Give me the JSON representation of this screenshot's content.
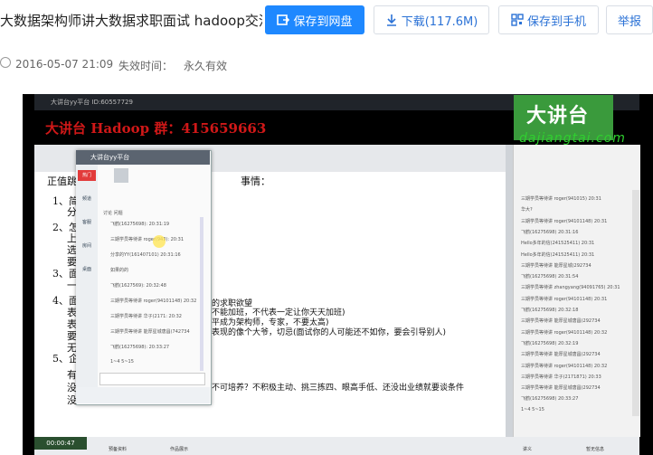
{
  "header": {
    "title": "大数据架构师讲大数据求职面试 hadoop交流...",
    "buttons": {
      "save_cloud": "保存到网盘",
      "download": "下载(117.6M)",
      "save_phone": "保存到手机",
      "report": "举报"
    },
    "meta": {
      "datetime": "2016-05-07 21:09",
      "expiry_label": "失效时间：",
      "expiry_value": "永久有效"
    }
  },
  "video": {
    "top_strip_text": "大讲台yy平台 ID:60557729",
    "banner_title": "大讲台 Hadoop 群：415659663",
    "logo_cn": "大讲台",
    "logo_url": "dajiangtai.com",
    "play_time": "00:00:47",
    "doc": {
      "lines": [
        "正值跳",
        "事情：",
        "1、简历",
        "分",
        "2、怎么",
        "上",
        "选",
        "要",
        "3、面试",
        "一",
        "4、面试",
        "表",
        "表",
        "要",
        "无",
        "5、企业",
        "有",
        "没",
        "没"
      ],
      "cn_lines": [
        "的求职欲望",
        "不能加班，不代表一定让你天天加班)",
        "平成为架构师，专家，不要太高)",
        "表现的像个大爷，切忌(面试你的人可能还不如你，要会引导别人)",
        "不可培养？不积极主动、挑三拣四、眼高手低、还没出业绩就要谈条件"
      ]
    },
    "popup": {
      "title": "大讲台yy平台",
      "nav": [
        "热门",
        "频道",
        "客服",
        "房间",
        "桌面"
      ],
      "tabs": "讨论  问题",
      "chat": [
        "飞鹤(16275698): 20:31:19",
        "三期学员等待讲 roger(943): 20:31",
        "分享的YY(161407101) 20:31:16",
        "如果的的",
        "飞鹤(1627569): 20:32:48",
        "三期学员等待讲 roger(94101148) 20:32",
        "三期学员等待讲 华子(2171: 20:32",
        "三期学员等待讲 能厚星城唐昌(742734",
        "飞鹤(16275698): 20:33:27",
        "1~4  5~15"
      ]
    },
    "side_chat": [
      "三期学员等待讲 roger(941015) 20:31",
      "华大?",
      "三期学员等待讲 roger(94101148) 20:31",
      "飞鹤(16275698) 20:31:16",
      "Hello多年的信(241525411) 20:31",
      "Hello多年的信(241525411) 20:31",
      "三期学员等待讲 能厚星城(292734",
      "飞鹤(16275698) 20:31:54",
      "三期学员等待讲 zhangyang(94091765) 20:31",
      "三期学员等待讲 roger(94101148) 20:31",
      "飞鹤(16275698) 20:32:18",
      "三期学员等待讲 能厚星城唐昌(292734",
      "三期学员等待讲 roger(94101148) 20:32",
      "飞鹤(16275698) 20:32:19",
      "三期学员等待讲 能厚星城唐昌(292734",
      "三期学员等待讲 roger(94101148) 20:32",
      "三期学员等待讲 华子(2171871) 20:33",
      "三期学员等待讲 能厚星城唐昌(292734",
      "飞鹤(16275698) 20:33:27",
      "1~4  5~15"
    ],
    "bottom_items": [
      "预备资料",
      "作品展示",
      "讲义",
      "暂无信息"
    ]
  },
  "colors": {
    "primary": "#1e88ff",
    "link": "#2b72d6",
    "banner_red": "#d01818",
    "logo_green": "#3a9a3c"
  }
}
